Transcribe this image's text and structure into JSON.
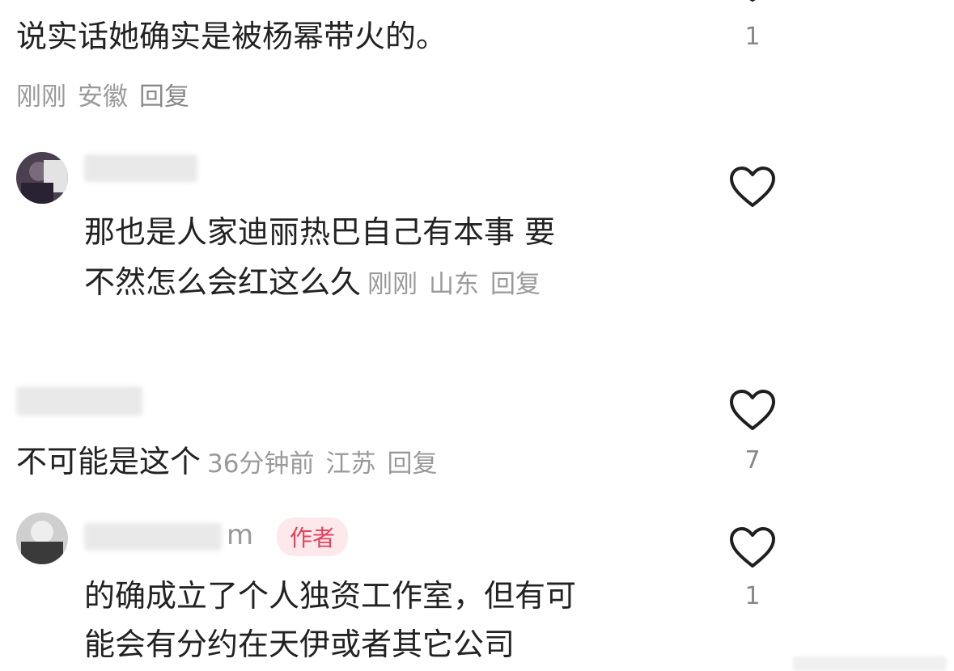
{
  "comments": [
    {
      "text": "说实话她确实是被杨幂带火的。",
      "time": "刚刚",
      "location": "安徽",
      "reply_label": "回复",
      "likes": "1"
    },
    {
      "username": "R...r",
      "text_line1": "那也是人家迪丽热巴自己有本事 要",
      "text_line2": "不然怎么会红这么久",
      "time": "刚刚",
      "location": "山东",
      "reply_label": "回复"
    },
    {
      "username": "C...",
      "text": "不可能是这个",
      "time": "36分钟前",
      "location": "江苏",
      "reply_label": "回复",
      "likes": "7"
    },
    {
      "username": "m",
      "badge": "作者",
      "text_line1": "的确成立了个人独资工作室，但有可",
      "text_line2": "能会有分约在天伊或者其它公司",
      "likes": "1"
    }
  ],
  "colors": {
    "text": "#222222",
    "meta": "#9a9a9a",
    "heart_stroke": "#1f1f1f",
    "badge_bg": "#fde9ec",
    "badge_text": "#e6405a"
  },
  "icons": {
    "like": "heart-outline-icon"
  }
}
